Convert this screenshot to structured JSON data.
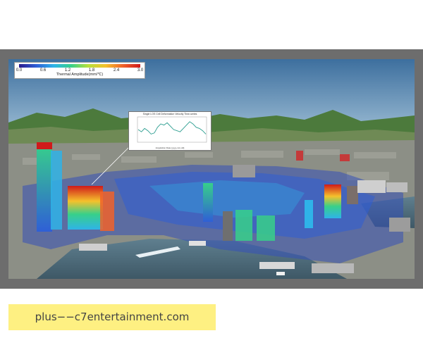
{
  "colorbar": {
    "title": "Thermal Amplitude(mm/℃)",
    "ticks": [
      "0.0",
      "0.6",
      "1.2",
      "1.8",
      "2.4",
      "3.0"
    ],
    "colors": [
      "#2a1a8c",
      "#2f5fd6",
      "#2fb3e8",
      "#37d08a",
      "#b8e03a",
      "#f5c12c",
      "#f0622a",
      "#d01a1a"
    ]
  },
  "inset_chart": {
    "title": "Single LOS Cell Deformation Velocity Time-series",
    "x_label": "Acquisition Date (yyyy-mm-dd)",
    "line_color": "#2a9d8f",
    "relative_values": [
      0.5,
      0.4,
      0.55,
      0.45,
      0.3,
      0.35,
      0.6,
      0.75,
      0.7,
      0.8,
      0.65,
      0.5,
      0.45,
      0.4,
      0.55,
      0.7,
      0.85,
      0.75,
      0.6,
      0.55,
      0.45,
      0.3
    ]
  },
  "banner": {
    "text": "plus−−c7entertainment.com",
    "background": "#fef082"
  }
}
